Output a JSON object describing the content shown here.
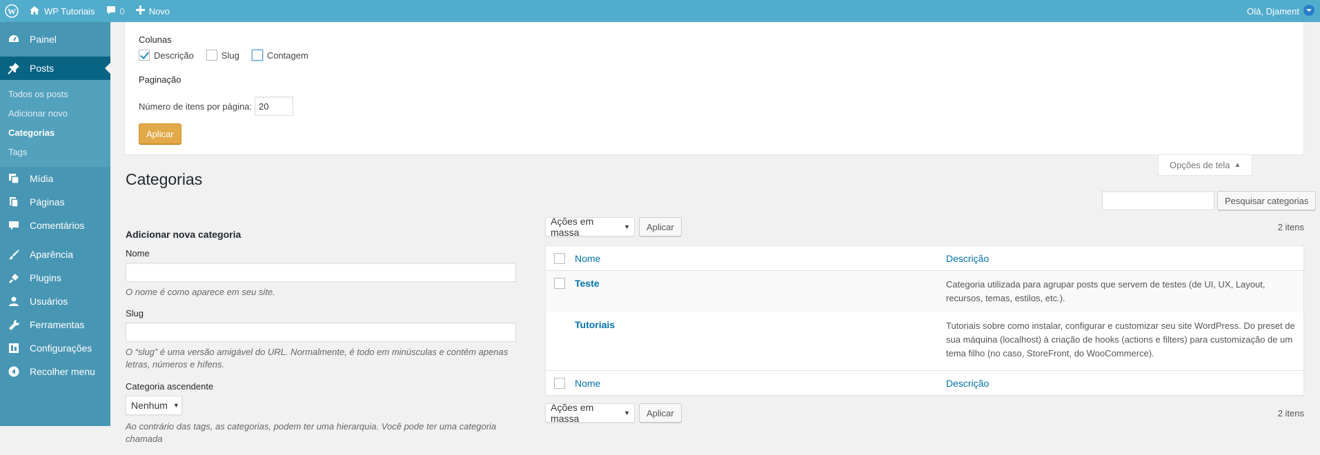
{
  "adminbar": {
    "site_name": "WP Tutoriais",
    "comments_count": "0",
    "new_label": "Novo",
    "greeting": "Olá, Djament"
  },
  "menu": {
    "dashboard": "Painel",
    "posts": "Posts",
    "posts_sub": [
      "Todos os posts",
      "Adicionar novo",
      "Categorias",
      "Tags"
    ],
    "media": "Mídia",
    "pages": "Páginas",
    "comments": "Comentários",
    "appearance": "Aparência",
    "plugins": "Plugins",
    "users": "Usuários",
    "tools": "Ferramentas",
    "settings": "Configurações",
    "collapse": "Recolher menu"
  },
  "screen_options": {
    "columns_title": "Colunas",
    "columns": [
      {
        "label": "Descrição",
        "checked": true
      },
      {
        "label": "Slug",
        "checked": false
      },
      {
        "label": "Contagem",
        "checked": false
      }
    ],
    "pagination_title": "Paginação",
    "per_page_label": "Número de itens por página:",
    "per_page_value": "20",
    "apply_label": "Aplicar",
    "tab_label": "Opções de tela"
  },
  "page": {
    "title": "Categorias"
  },
  "search": {
    "button_label": "Pesquisar categorias"
  },
  "form": {
    "heading": "Adicionar nova categoria",
    "name_label": "Nome",
    "name_help": "O nome é como aparece em seu site.",
    "slug_label": "Slug",
    "slug_help": "O “slug” é uma versão amigável do URL. Normalmente, é todo em minúsculas e contém apenas letras, números e hífens.",
    "parent_label": "Categoria ascendente",
    "parent_value": "Nenhum",
    "parent_help": "Ao contrário das tags, as categorias, podem ter uma hierarquia. Você pode ter uma categoria chamada"
  },
  "table": {
    "bulk_actions": "Ações em massa",
    "apply_label": "Aplicar",
    "count": "2 itens",
    "col_name": "Nome",
    "col_desc": "Descrição",
    "rows": [
      {
        "name": "Teste",
        "description": "Categoria utilizada para agrupar posts que servem de testes (de UI, UX, Layout, recursos, temas, estilos, etc.)."
      },
      {
        "name": "Tutoriais",
        "description": "Tutoriais sobre como instalar, configurar e customizar seu site WordPress. Do preset de sua máquina (localhost) à criação de hooks (actions e filters) para customização de um tema filho (no caso, StoreFront, do WooCommerce)."
      }
    ]
  },
  "colors": {
    "adminbar": "#52accc",
    "menu": "#4796b3",
    "menu_current": "#096484",
    "link": "#0073aa",
    "primary_button": "#e1a948"
  }
}
